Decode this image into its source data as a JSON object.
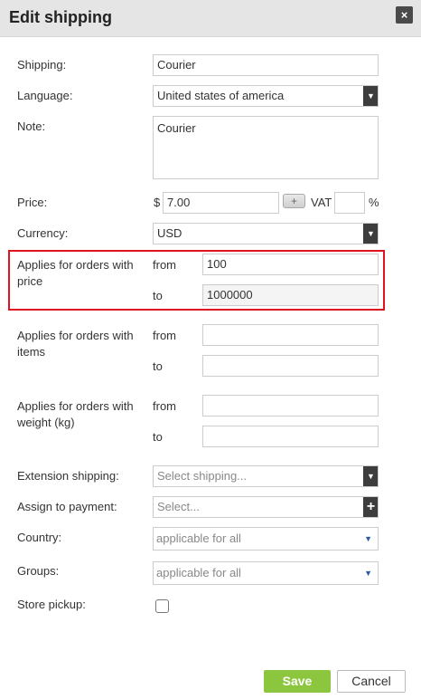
{
  "dialog": {
    "title": "Edit shipping",
    "close_icon": "×"
  },
  "shipping": {
    "label": "Shipping:",
    "value": "Courier"
  },
  "language": {
    "label": "Language:",
    "value": "United states of america"
  },
  "note": {
    "label": "Note:",
    "value": "Courier"
  },
  "price": {
    "label": "Price:",
    "currency_symbol": "$",
    "value": "7.00",
    "plus_label": "+",
    "vat_label": "VAT",
    "vat_value": "",
    "percent": "%"
  },
  "currency": {
    "label": "Currency:",
    "value": "USD"
  },
  "orders_price": {
    "label": "Applies for orders with price",
    "from_label": "from",
    "from_value": "100",
    "to_label": "to",
    "to_value": "1000000"
  },
  "orders_items": {
    "label": "Applies for orders with items",
    "from_label": "from",
    "from_value": "",
    "to_label": "to",
    "to_value": ""
  },
  "orders_weight": {
    "label": "Applies for orders with weight (kg)",
    "from_label": "from",
    "from_value": "",
    "to_label": "to",
    "to_value": ""
  },
  "extension_shipping": {
    "label": "Extension shipping:",
    "placeholder": "Select shipping..."
  },
  "assign_payment": {
    "label": "Assign to payment:",
    "placeholder": "Select...",
    "add_icon": "+"
  },
  "country": {
    "label": "Country:",
    "value": "applicable for all"
  },
  "groups": {
    "label": "Groups:",
    "value": "applicable for all"
  },
  "store_pickup": {
    "label": "Store pickup:",
    "checked": false
  },
  "actions": {
    "save_label": "Save",
    "cancel_label": "Cancel"
  },
  "colors": {
    "save_bg": "#8cc63e",
    "highlight": "#e0141e",
    "header_bg": "#e5e5e5"
  }
}
